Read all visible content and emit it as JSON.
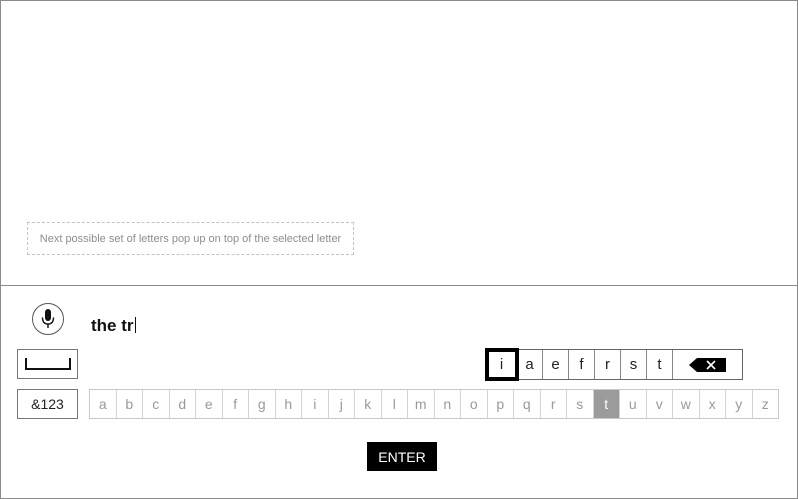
{
  "hint": {
    "text": "Next possible set of letters pop up on top of the selected letter"
  },
  "input": {
    "typed_text": "the tr"
  },
  "keys": {
    "symbols_label": "&123",
    "enter_label": "ENTER"
  },
  "suggestions": [
    "i",
    "a",
    "e",
    "f",
    "r",
    "s",
    "t"
  ],
  "alphabet": [
    "a",
    "b",
    "c",
    "d",
    "e",
    "f",
    "g",
    "h",
    "i",
    "j",
    "k",
    "l",
    "m",
    "n",
    "o",
    "p",
    "q",
    "r",
    "s",
    "t",
    "u",
    "v",
    "w",
    "x",
    "y",
    "z"
  ],
  "state": {
    "selected_suggestion": "i",
    "highlighted_letter": "t"
  },
  "icons": {
    "mic": "microphone-icon",
    "space": "space-bar-icon",
    "backspace": "backspace-icon"
  }
}
